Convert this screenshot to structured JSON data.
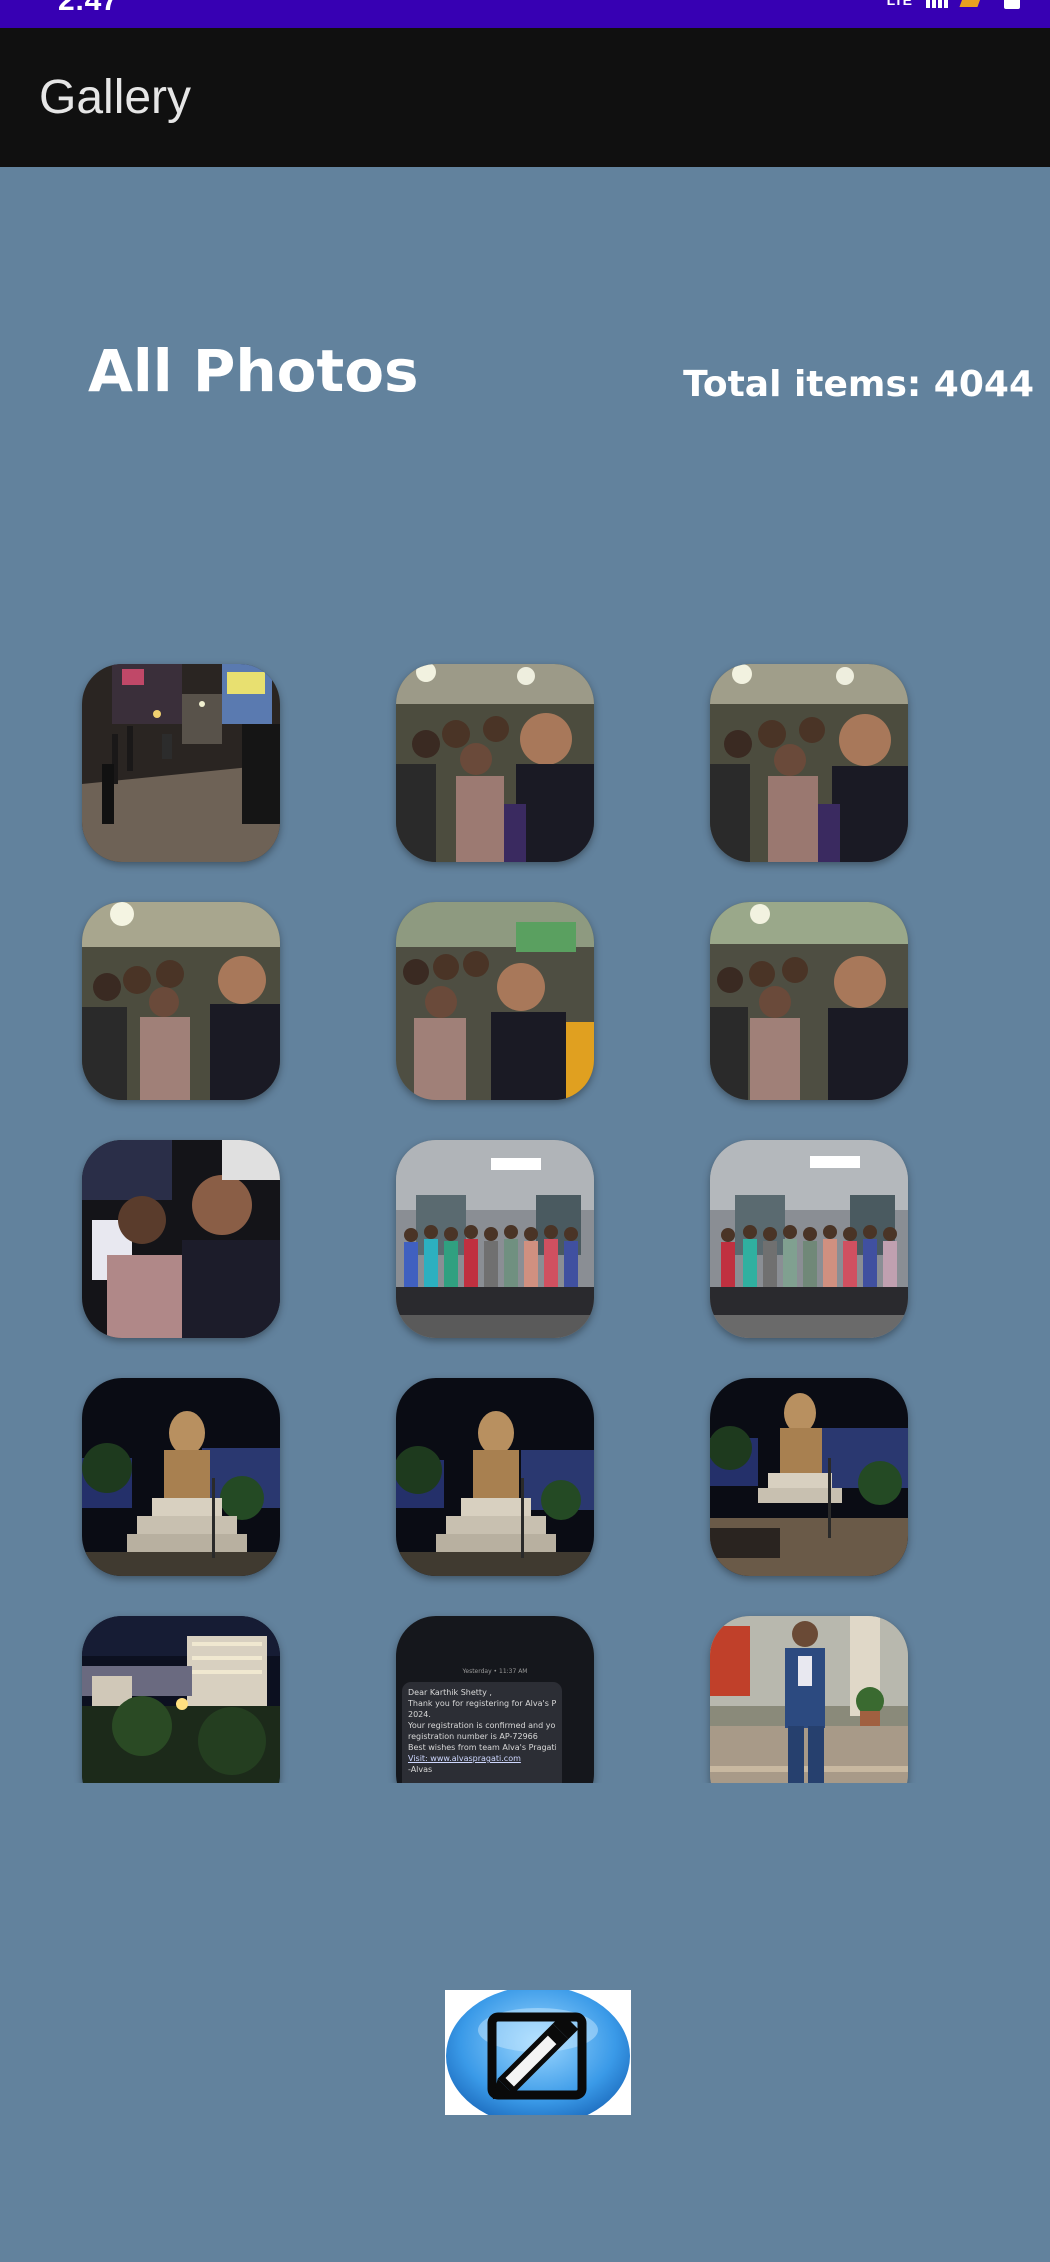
{
  "status_bar": {
    "time": "2:47",
    "network": "LTE",
    "signal_icon": "signal-icon",
    "battery_icon": "battery-icon"
  },
  "app_bar": {
    "title": "Gallery"
  },
  "header": {
    "title": "All Photos",
    "total_items": "Total items: 4044"
  },
  "photos": [
    {
      "subject": "night street with shops"
    },
    {
      "subject": "group selfie of friends at night"
    },
    {
      "subject": "group selfie of friends at night"
    },
    {
      "subject": "group selfie of friends at night"
    },
    {
      "subject": "group selfie of friends at night"
    },
    {
      "subject": "group selfie of friends at night"
    },
    {
      "subject": "selfie of two friends"
    },
    {
      "subject": "group photo in a hall"
    },
    {
      "subject": "group photo in a hall"
    },
    {
      "subject": "statue lit at night"
    },
    {
      "subject": "statue lit at night"
    },
    {
      "subject": "statue lit at night"
    },
    {
      "subject": "campus building at night"
    },
    {
      "subject": "registration message screenshot",
      "message": {
        "time": "Yesterday • 11:37 AM",
        "lines": [
          "Dear Karthik Shetty ,",
          "Thank you for registering for Alva's Pragati",
          "2024.",
          "Your registration is confirmed and your",
          "registration number is AP-72966",
          "Best wishes from team Alva's Pragati",
          "Visit: www.alvaspragati.com",
          "-Alvas"
        ]
      }
    },
    {
      "subject": "man in blue suit"
    }
  ],
  "fab": {
    "icon": "edit-icon"
  }
}
